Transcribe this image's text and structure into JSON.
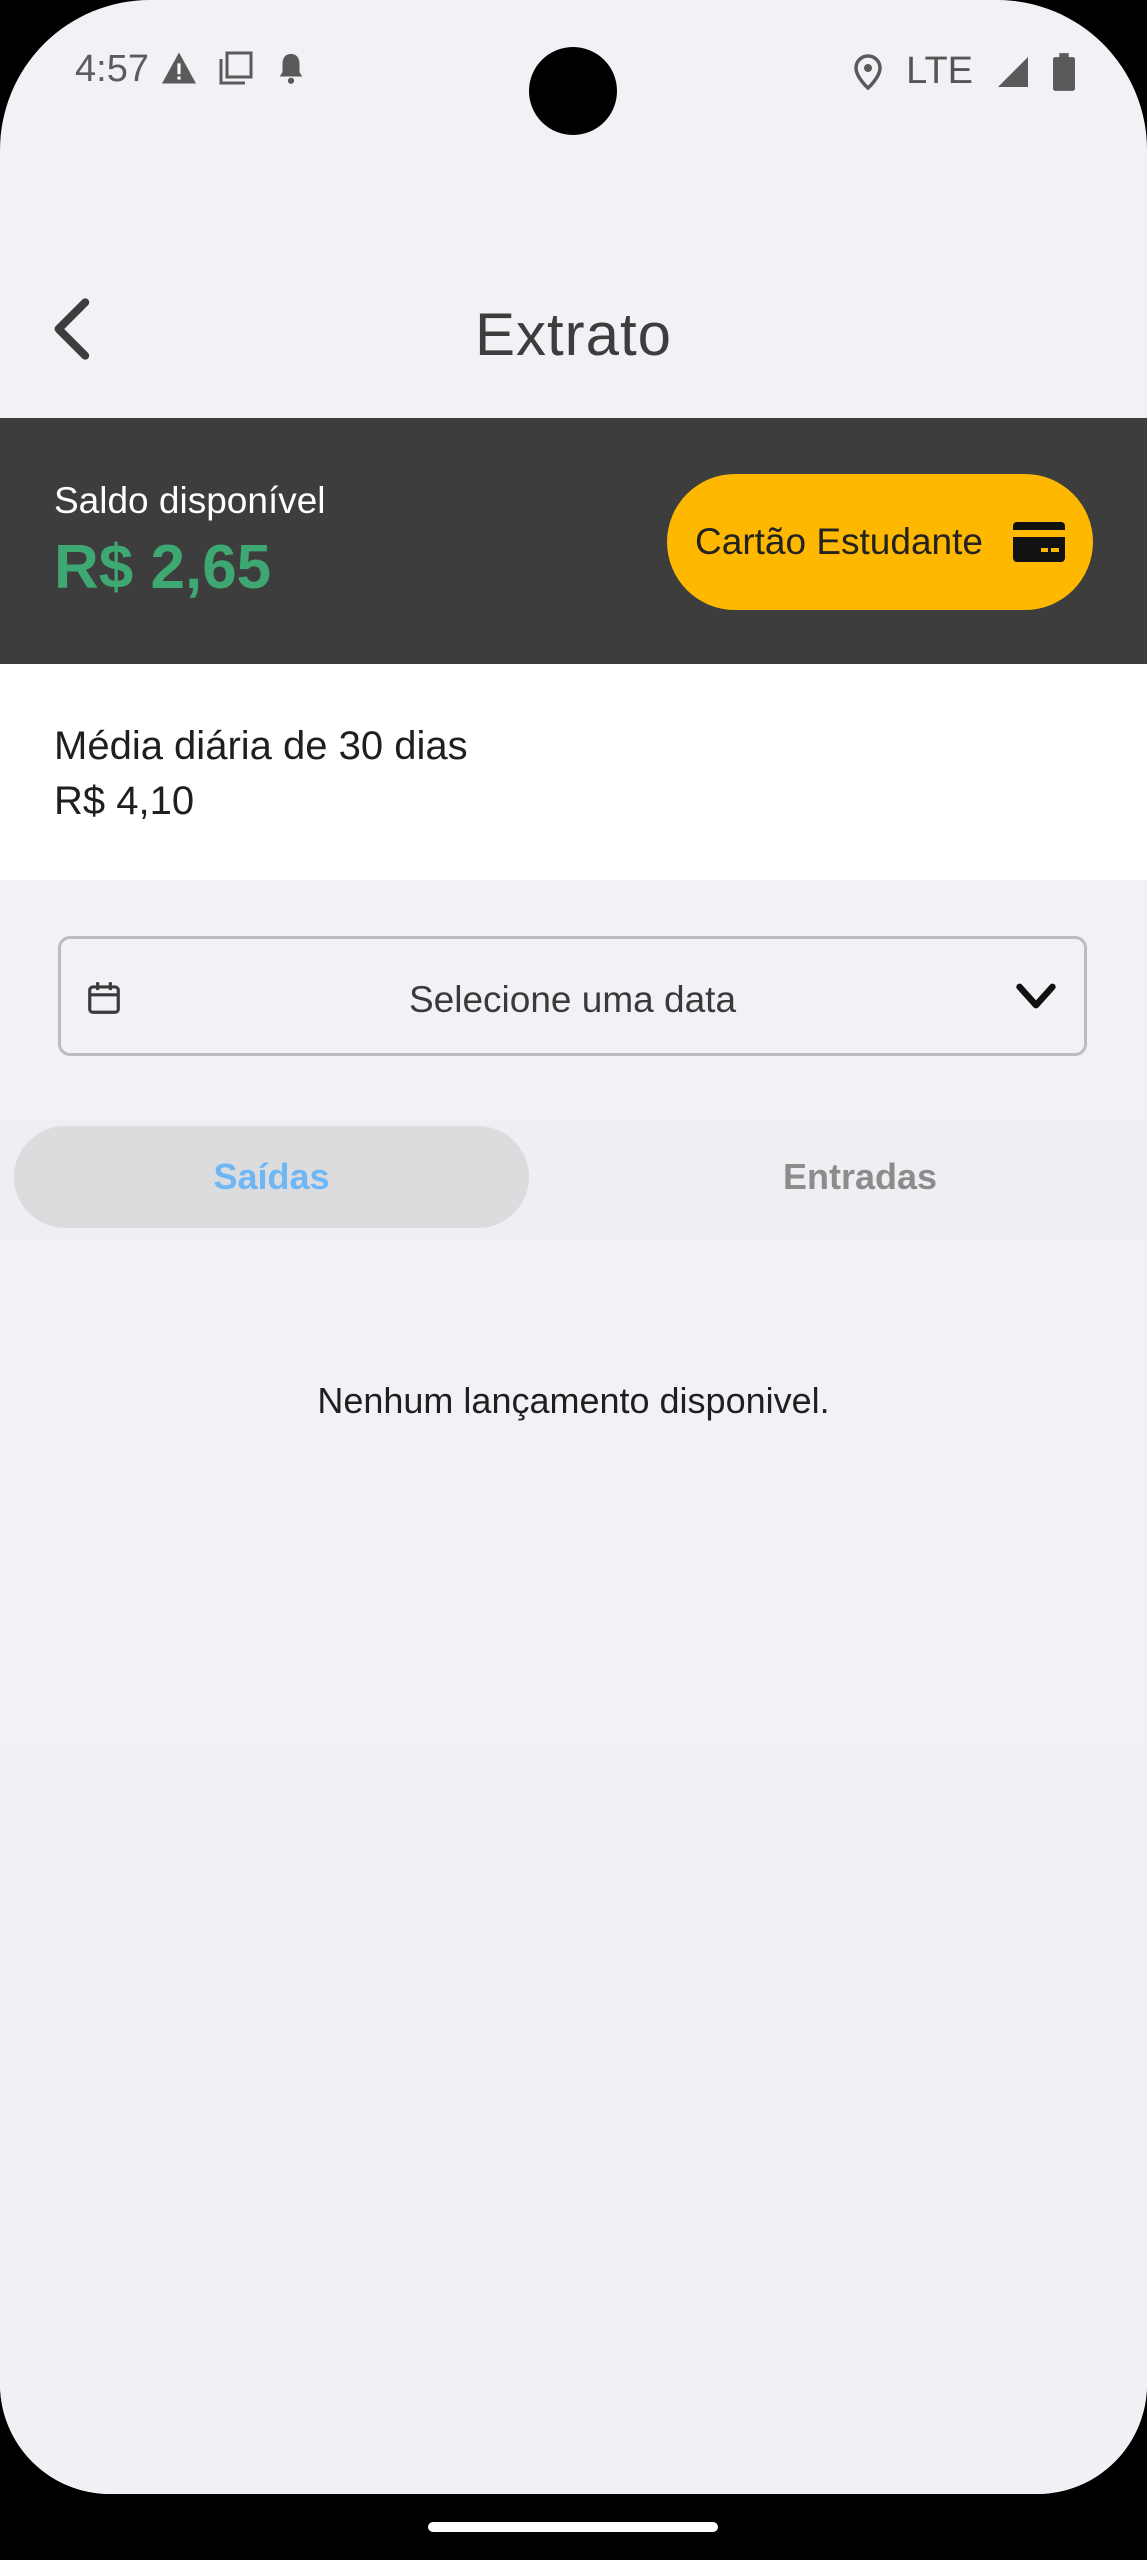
{
  "status_bar": {
    "time": "4:57",
    "network": "LTE",
    "icons_left": [
      "warning-icon",
      "screenshot-icon",
      "notification-bell-icon"
    ],
    "icons_right": [
      "location-icon",
      "signal-icon",
      "battery-icon"
    ]
  },
  "header": {
    "title": "Extrato",
    "back_icon": "chevron-left-icon"
  },
  "balance": {
    "label": "Saldo disponível",
    "value": "R$ 2,65",
    "card_button_label": "Cartão Estudante",
    "card_icon": "credit-card-icon"
  },
  "average": {
    "label": "Média diária de 30 dias",
    "value": "R$ 4,10"
  },
  "date_filter": {
    "placeholder": "Selecione uma data",
    "icon": "calendar-icon",
    "dropdown_icon": "chevron-down-icon"
  },
  "tabs": [
    {
      "label": "Saídas",
      "selected": true
    },
    {
      "label": "Entradas",
      "selected": false
    }
  ],
  "list": {
    "empty_message": "Nenhum lançamento disponivel."
  },
  "colors": {
    "accent_yellow": "#ffb800",
    "balance_green": "#3ea872",
    "dark_panel": "#3d3d3d",
    "tab_selected_text": "#6db7f5"
  }
}
